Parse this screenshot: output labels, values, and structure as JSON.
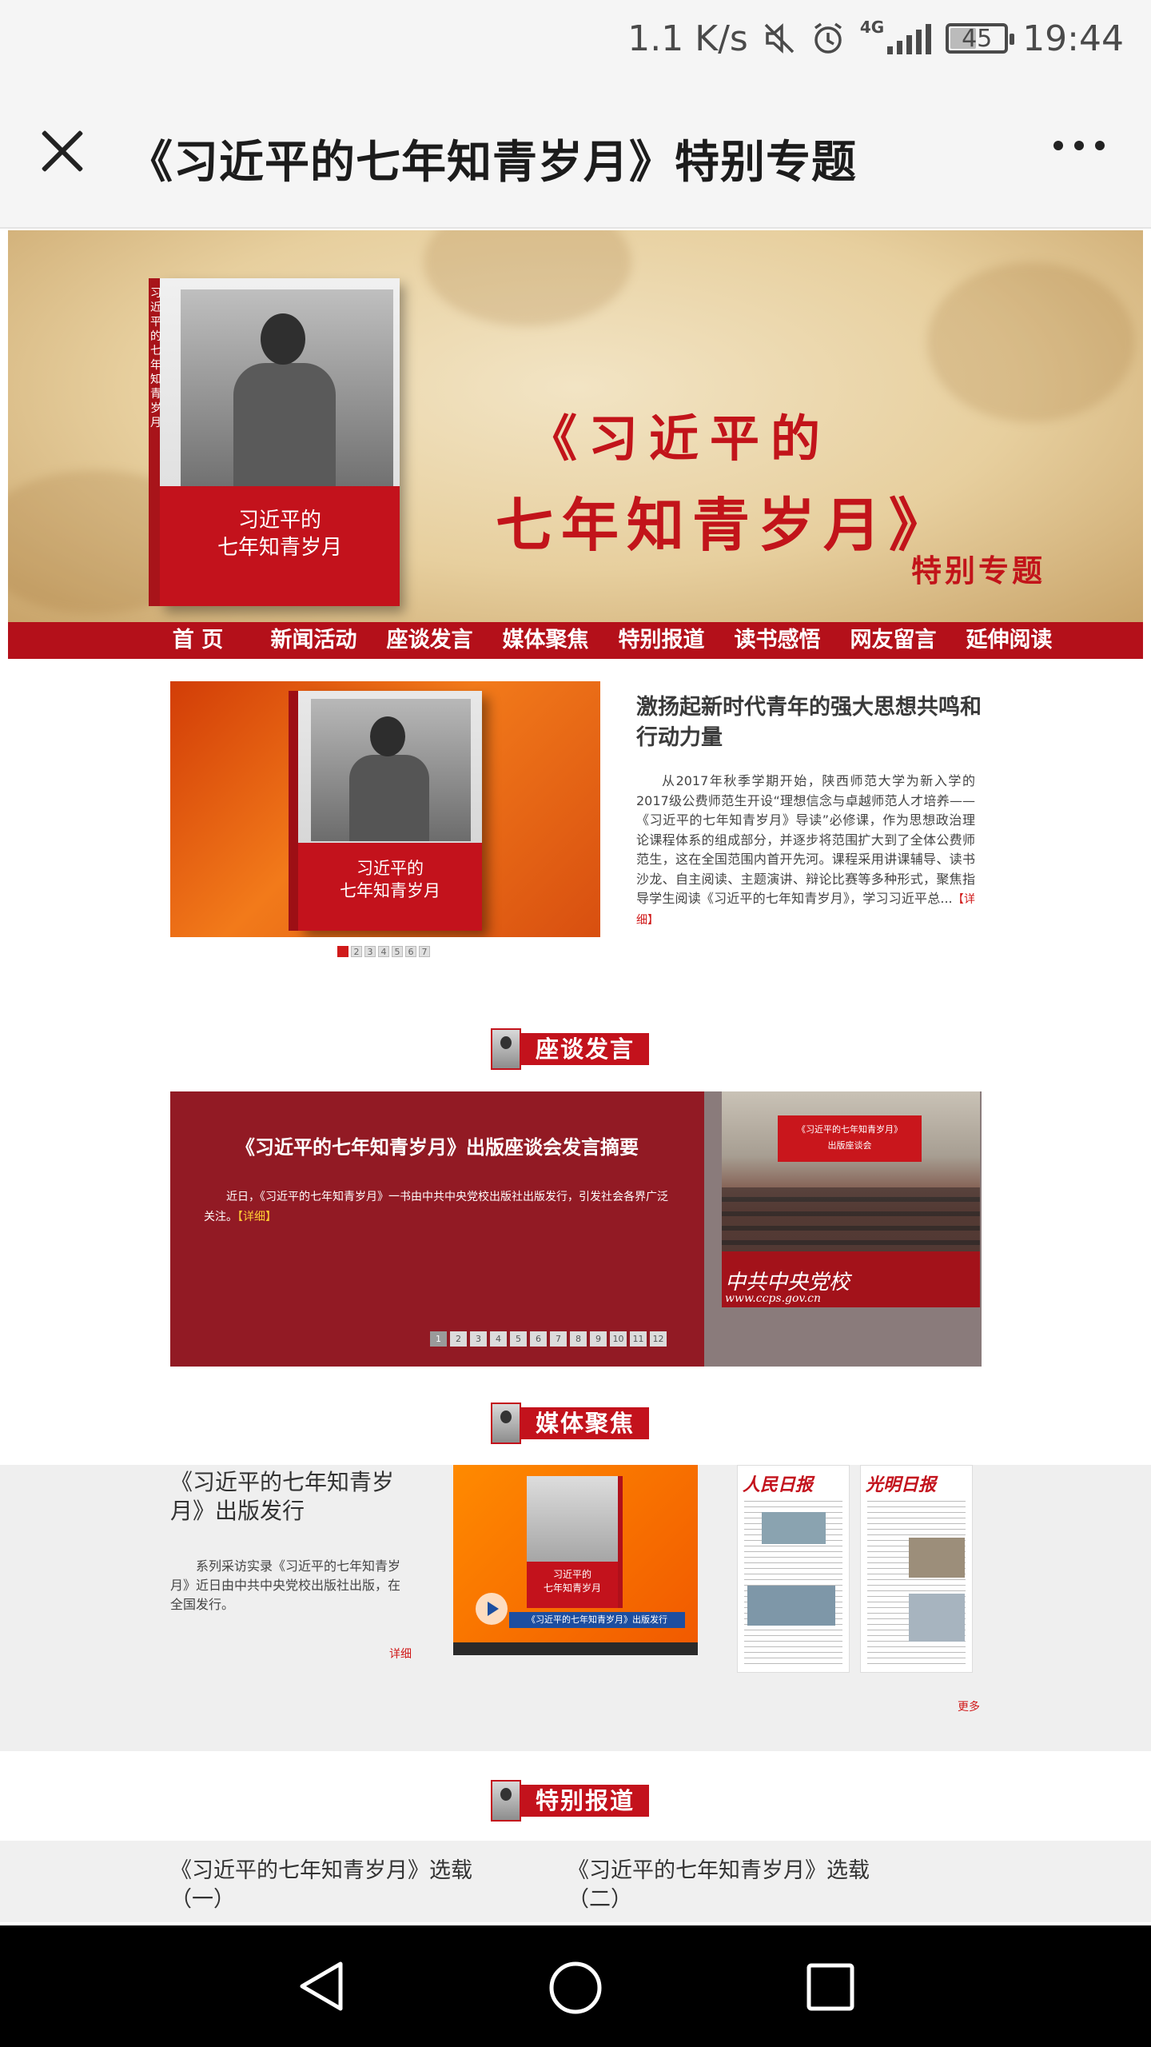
{
  "status_bar": {
    "net_speed": "1.1 K/s",
    "network": "4G",
    "battery": "45",
    "time": "19:44"
  },
  "title_bar": {
    "title": "《习近平的七年知青岁月》特别专题"
  },
  "banner": {
    "title_line1": "《习近平的",
    "title_line2": "七年知青岁月》",
    "subtitle": "特别专题",
    "book_title": "习近平的\n七年知青岁月",
    "book_spine": "习近平的七年知青岁月"
  },
  "nav": {
    "items": [
      "首 页",
      "新闻活动",
      "座谈发言",
      "媒体聚焦",
      "特别报道",
      "读书感悟",
      "网友留言",
      "延伸阅读"
    ]
  },
  "feature": {
    "book_title": "习近平的\n七年知青岁月",
    "pager": [
      "1",
      "2",
      "3",
      "4",
      "5",
      "6",
      "7"
    ],
    "pager_active": 1,
    "title": "激扬起新时代青年的强大思想共鸣和行动力量",
    "text": "从2017年秋季学期开始，陕西师范大学为新入学的2017级公费师范生开设“理想信念与卓越师范人才培养——《习近平的七年知青岁月》导读”必修课，作为思想政治理论课程体系的组成部分，并逐步将范围扩大到了全体公费师范生，这在全国范围内首开先河。课程采用讲课辅导、读书沙龙、自主阅读、主题演讲、辩论比赛等多种形式，聚焦指导学生阅读《习近平的七年知青岁月》，学习习近平总...",
    "detail": "【详细】"
  },
  "symposium": {
    "section_label": "座谈发言",
    "headline": "《习近平的七年知青岁月》出版座谈会发言摘要",
    "summary": "近日，《习近平的七年知青岁月》一书由中共中央党校出版社出版发行，引发社会各界广泛关注。",
    "detail": "【详细】",
    "photo_banner": "《习近平的七年知青岁月》\n出版座谈会",
    "watermark": "中共中央党校",
    "watermark_url": "www.ccps.gov.cn",
    "pager": [
      "1",
      "2",
      "3",
      "4",
      "5",
      "6",
      "7",
      "8",
      "9",
      "10",
      "11",
      "12"
    ],
    "pager_active": 1
  },
  "media": {
    "section_label": "媒体聚焦",
    "title": "《习近平的七年知青岁月》出版发行",
    "text": "系列采访实录《习近平的七年知青岁月》近日由中共中央党校出版社出版，在全国发行。",
    "detail": "详细",
    "video_book_title": "习近平的\n七年知青岁月",
    "video_caption": "《习近平的七年知青岁月》出版发行",
    "paper1_masthead": "人民日报",
    "paper2_masthead": "光明日报",
    "more": "更多"
  },
  "reports": {
    "section_label": "特别报道",
    "items": [
      "《习近平的七年知青岁月》选载（一）",
      "《习近平的七年知青岁月》选载（二）"
    ]
  },
  "colors": {
    "brand_red": "#c3121c",
    "nav_red": "#b4101a",
    "symposium_bg": "#921a24"
  }
}
